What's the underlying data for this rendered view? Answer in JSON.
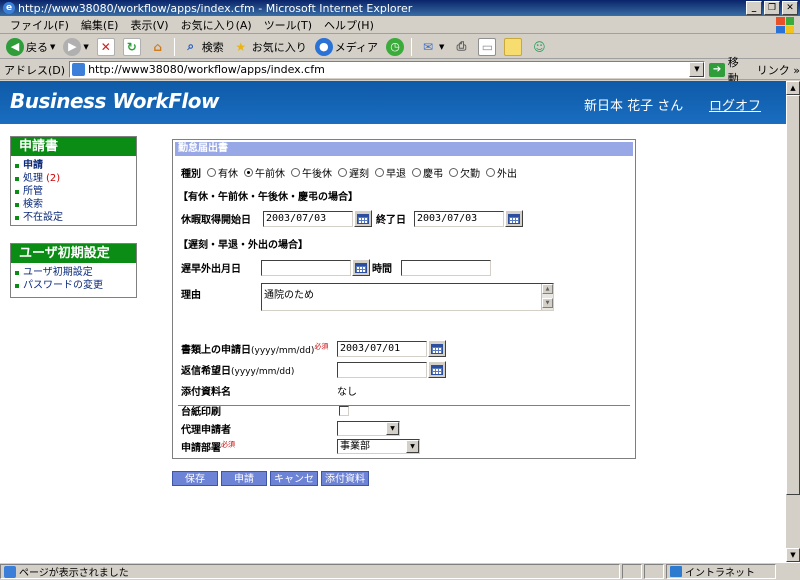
{
  "window": {
    "title": "http://www38080/workflow/apps/index.cfm - Microsoft Internet Explorer"
  },
  "menu": [
    "ファイル(F)",
    "編集(E)",
    "表示(V)",
    "お気に入り(A)",
    "ツール(T)",
    "ヘルプ(H)"
  ],
  "toolbar": {
    "back_label": "戻る",
    "search_label": "検索",
    "favorites_label": "お気に入り",
    "media_label": "メディア"
  },
  "address": {
    "label": "アドレス(D)",
    "url": "http://www38080/workflow/apps/index.cfm",
    "go_label": "移動",
    "links_label": "リンク »"
  },
  "header": {
    "brand": "Business WorkFlow",
    "user": "新日本 花子 さん",
    "logout": "ログオフ"
  },
  "sidebar": {
    "apply": {
      "title": "申請書",
      "items": [
        {
          "label": "申請",
          "count": ""
        },
        {
          "label": "処理",
          "count": "(2)"
        },
        {
          "label": "所管",
          "count": ""
        },
        {
          "label": "検索",
          "count": ""
        },
        {
          "label": "不在設定",
          "count": ""
        }
      ]
    },
    "user_settings": {
      "title": "ユーザ初期設定",
      "items": [
        {
          "label": "ユーザ初期設定"
        },
        {
          "label": "パスワードの変更"
        }
      ]
    }
  },
  "form": {
    "title": "勤怠届出書",
    "type_label": "種別",
    "types": [
      {
        "label": "有休",
        "checked": false
      },
      {
        "label": "午前休",
        "checked": true
      },
      {
        "label": "午後休",
        "checked": false
      },
      {
        "label": "遅刻",
        "checked": false
      },
      {
        "label": "早退",
        "checked": false
      },
      {
        "label": "慶弔",
        "checked": false
      },
      {
        "label": "欠勤",
        "checked": false
      },
      {
        "label": "外出",
        "checked": false
      }
    ],
    "note_leave": "【有休・午前休・午後休・慶弔の場合】",
    "leave_start_label": "休暇取得開始日",
    "leave_start_value": "2003/07/03",
    "leave_end_label": "終了日",
    "leave_end_value": "2003/07/03",
    "note_late": "【遅刻・早退・外出の場合】",
    "late_date_label": "遅早外出月日",
    "late_date_value": "",
    "time_label": "時間",
    "time_value": "",
    "reason_label": "理由",
    "reason_value": "通院のため",
    "apply_date_label": "書類上の申請日",
    "apply_date_fmt": "(yyyy/mm/dd)",
    "required_mark": "必須",
    "apply_date_value": "2003/07/01",
    "reply_date_label": "返信希望日",
    "reply_date_fmt": "(yyyy/mm/dd)",
    "reply_date_value": "",
    "attachment_label": "添付資料名",
    "attachment_value": "なし",
    "print_label": "台紙印刷",
    "print_checked": false,
    "proxy_label": "代理申請者",
    "proxy_value": "",
    "dept_label": "申請部署",
    "dept_value": "事業部"
  },
  "actions": [
    "保存",
    "申請",
    "キャンセル",
    "添付資料"
  ],
  "status": {
    "text": "ページが表示されました",
    "zone": "イントラネット"
  },
  "colors": {
    "header_blue": "#0e5aa8",
    "sidebar_green": "#0b8c14",
    "form_header": "#98a8e6",
    "button": "#6d83d6",
    "required_red": "#d00000"
  }
}
